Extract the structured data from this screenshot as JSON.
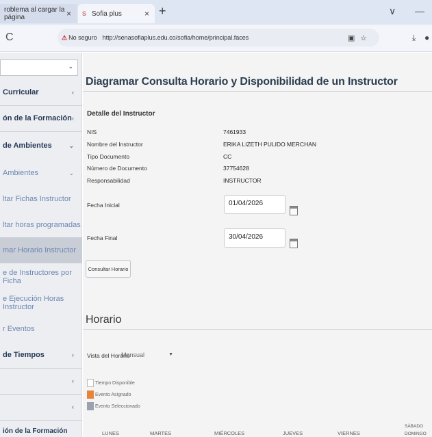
{
  "browser": {
    "tabs": [
      {
        "label": "roblema al cargar la página",
        "close": "×"
      },
      {
        "label": "Sofia plus",
        "close": "×"
      }
    ],
    "new_tab": "+",
    "window_controls": [
      "∨",
      "—"
    ],
    "security_label": "No seguro",
    "url": "http://senasofiaplus.edu.co/sofia/home/principal.faces",
    "reload_glyph": "C"
  },
  "sidebar": {
    "items": [
      {
        "label": "Curricular",
        "style": "bold",
        "arrow": "‹"
      },
      {
        "label": "ón de la Formación",
        "style": "bold",
        "arrow": "‹"
      },
      {
        "label": "de Ambientes",
        "style": "bold",
        "arrow": "⌄"
      },
      {
        "label": "Ambientes",
        "style": "light",
        "arrow": "⌄"
      },
      {
        "label": "ltar Fichas Instructor",
        "style": "light",
        "arrow": ""
      },
      {
        "label": "ltar horas programadas",
        "style": "light",
        "arrow": ""
      },
      {
        "label": "mar Horario Instructor",
        "style": "active",
        "arrow": ""
      },
      {
        "label": "e de Instructores por Ficha",
        "style": "light",
        "arrow": ""
      },
      {
        "label": "e Ejecución Horas Instructor",
        "style": "light",
        "arrow": ""
      },
      {
        "label": "r Eventos",
        "style": "light",
        "arrow": ""
      },
      {
        "label": "de Tiempos",
        "style": "bold",
        "arrow": "‹"
      },
      {
        "label": "",
        "style": "bold",
        "arrow": "‹"
      },
      {
        "label": "",
        "style": "bold",
        "arrow": "‹"
      },
      {
        "label": "ión de la Formación",
        "style": "bold",
        "arrow": ""
      }
    ]
  },
  "main": {
    "title": "Diagramar Consulta Horario y Disponibilidad de un Instructor",
    "section_title": "Detalle del Instructor",
    "details": [
      {
        "label": "NIS",
        "value": "7461933"
      },
      {
        "label": "Nombre del Instructor",
        "value": "ERIKA LIZETH PULIDO MERCHAN"
      },
      {
        "label": "Tipo Documento",
        "value": "CC"
      },
      {
        "label": "Número de Documento",
        "value": "37754628"
      },
      {
        "label": "Responsabilidad",
        "value": "INSTRUCTOR"
      }
    ],
    "fecha_inicial": {
      "label": "Fecha Inicial",
      "value": "01/04/2026"
    },
    "fecha_final": {
      "label": "Fecha Final",
      "value": "30/04/2026"
    },
    "consult_button": "Consultar Horario",
    "horario_title": "Horario",
    "vista_label": "Vista del Horario",
    "vista_value": "Mensual",
    "legend": [
      {
        "label": "Tiempo Disponible",
        "color": "#ffffff"
      },
      {
        "label": "Evento Asignado",
        "color": "#e8833a"
      },
      {
        "label": "Evento Seleccionado",
        "color": "#9aa3ad"
      }
    ],
    "days": [
      "LUNES",
      "MARTES",
      "MIÉRCOLES",
      "JUEVES",
      "VIERNES",
      "SÁBADO",
      "DOMINGO"
    ]
  }
}
